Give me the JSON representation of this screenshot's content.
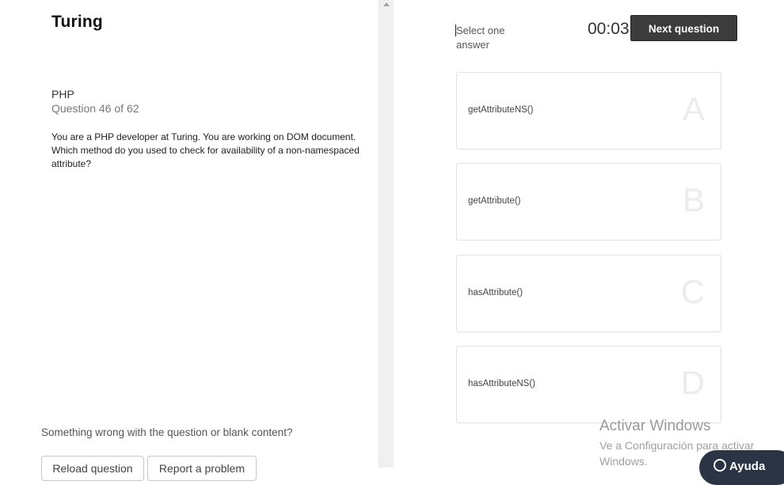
{
  "brand": {
    "logo": "Turing"
  },
  "question": {
    "subject": "PHP",
    "counter": "Question 46 of 62",
    "text": "You are a PHP developer at Turing. You are working on DOM document. Which method do you used to check for availability of a non-namespaced attribute?"
  },
  "footer": {
    "problem_text": "Something wrong with the question or blank content?",
    "reload_label": "Reload question",
    "report_label": "Report a problem"
  },
  "answer_panel": {
    "instruction": "Select one answer",
    "timer": "00:03",
    "next_label": "Next question",
    "options": [
      {
        "text": "getAttributeNS()",
        "letter": "A"
      },
      {
        "text": "getAttribute()",
        "letter": "B"
      },
      {
        "text": "hasAttribute()",
        "letter": "C"
      },
      {
        "text": "hasAttributeNS()",
        "letter": "D"
      }
    ]
  },
  "windows_watermark": {
    "title": "Activar Windows",
    "subtitle": "Ve a Configuración para activar Windows."
  },
  "help_button": {
    "label": "Ayuda",
    "icon": "help-circle-icon"
  }
}
